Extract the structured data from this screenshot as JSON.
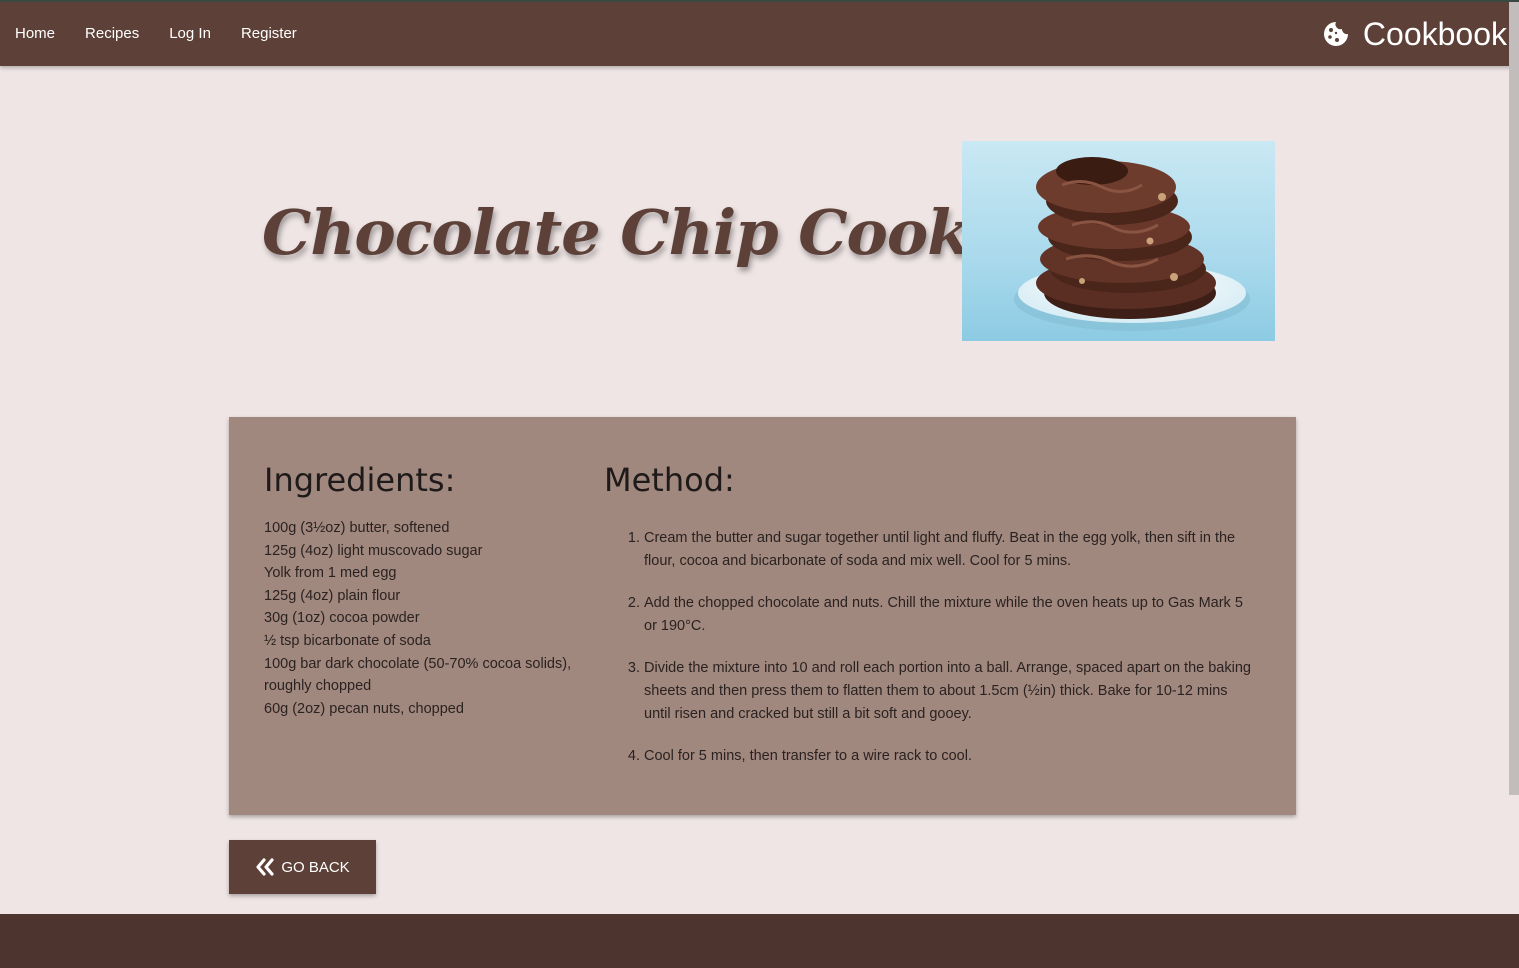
{
  "nav": {
    "links": [
      "Home",
      "Recipes",
      "Log In",
      "Register"
    ],
    "brand": "Cookbook",
    "brand_icon": "cookie-icon"
  },
  "recipe": {
    "title": "Chocolate Chip Cookies",
    "image_icon": "cookie-stack-photo",
    "ingredients_heading": "Ingredients:",
    "ingredients": [
      "100g (3½oz) butter, softened",
      "125g (4oz) light muscovado sugar",
      "Yolk from 1 med egg",
      "125g (4oz) plain flour",
      "30g (1oz) cocoa powder",
      "½ tsp bicarbonate of soda",
      "100g bar dark chocolate (50-70% cocoa solids), roughly chopped",
      "60g (2oz) pecan nuts, chopped"
    ],
    "method_heading": "Method:",
    "method": [
      "Cream the butter and sugar together until light and fluffy. Beat in the egg yolk, then sift in the flour, cocoa and bicarbonate of soda and mix well. Cool for 5 mins.",
      "Add the chopped chocolate and nuts. Chill the mixture while the oven heats up to Gas Mark 5 or 190°C.",
      "Divide the mixture into 10 and roll each portion into a ball. Arrange, spaced apart on the baking sheets and then press them to flatten them to about 1.5cm (½in) thick. Bake for 10-12 mins until risen and cracked but still a bit soft and gooey.",
      "Cool for 5 mins, then transfer to a wire rack to cool."
    ]
  },
  "back_button": {
    "label": "GO BACK",
    "icon": "double-chevron-left-icon"
  },
  "colors": {
    "navbar": "#5d4037",
    "page_bg": "#efe5e5",
    "card_bg": "#a1887f",
    "footer": "#4e342e"
  }
}
